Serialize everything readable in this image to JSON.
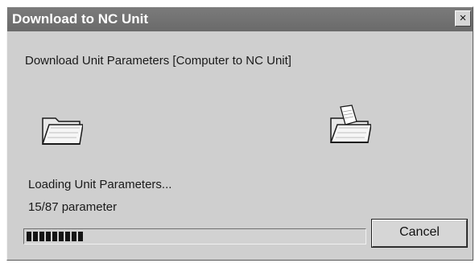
{
  "window": {
    "title": "Download to NC Unit",
    "close_glyph": "×"
  },
  "main": {
    "subtitle": "Download Unit Parameters [Computer to NC Unit]",
    "source_icon": "open-folder-icon",
    "destination_icon": "folder-with-document-icon",
    "status_line1": "Loading Unit Parameters...",
    "status_line2": "15/87 parameter"
  },
  "progress": {
    "current": 15,
    "total": 87,
    "fraction": 0.1724
  },
  "buttons": {
    "cancel_label": "Cancel"
  }
}
